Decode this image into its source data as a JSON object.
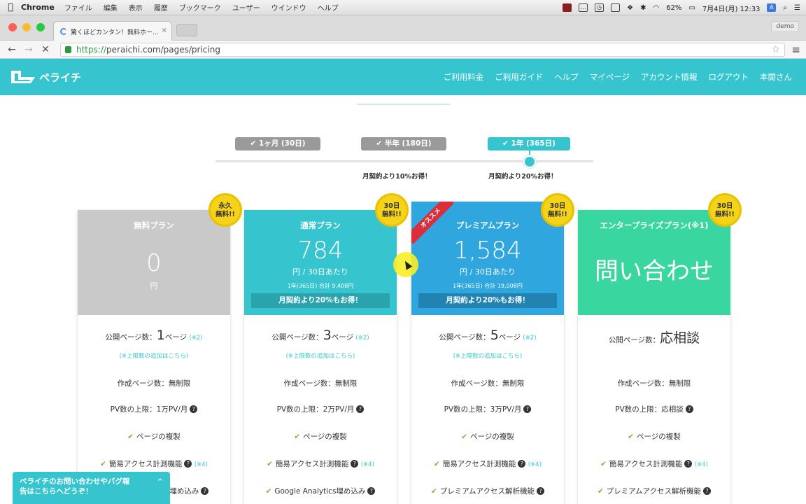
{
  "menubar": {
    "apple": "",
    "app": "Chrome",
    "items": [
      "ファイル",
      "編集",
      "表示",
      "履歴",
      "ブックマーク",
      "ユーザー",
      "ウインドウ",
      "ヘルプ"
    ],
    "battery": "62%",
    "clock": "7月4日(月)  12:33"
  },
  "browser": {
    "tab_title": "驚くほどカンタン！無料ホー...",
    "tab_close": "×",
    "profile": "demo",
    "url_scheme": "https://",
    "url_rest": "peraichi.com/pages/pricing"
  },
  "site": {
    "logo_text": "ペライチ",
    "nav": [
      "ご利用料金",
      "ご利用ガイド",
      "ヘルプ",
      "マイページ",
      "アカウント情報",
      "ログアウト",
      "本間さん"
    ]
  },
  "terms": {
    "options": [
      "✔ 1ヶ月 (30日)",
      "✔ 半年 (180日)",
      "✔ 1年 (365日)"
    ],
    "selected": "✔ 1年 (365日)",
    "discount_half": "月契約より10%お得！",
    "discount_year": "月契約より20%お得！"
  },
  "badges": [
    "永久\n無料!!",
    "30日\n無料!!",
    "30日\n無料!!",
    "30日\n無料!!"
  ],
  "ribbon": "オススメ",
  "plans": [
    {
      "name": "無料プラン",
      "price": "0",
      "unit": "円",
      "pages_label": "公開ページ数：",
      "pages_value": "1",
      "pages_suffix": "ページ",
      "pages_note": "(※2)",
      "pages_link": "(※上限数の追加はこちら)",
      "create_pages": "作成ページ数：無制限",
      "pv": "PV数の上限：1万PV/月",
      "feature_copy": "ページの複製",
      "feature_access": "簡易アクセス計測機能",
      "feature_access_note": "(※4)",
      "feature_extra": "Google Analytics埋め込み"
    },
    {
      "name": "通常プラン",
      "price": "784",
      "unit": "円 / 30日あたり",
      "total": "1年(365日) 合計 9,408円",
      "promo": "月契約より20%もお得！",
      "pages_label": "公開ページ数：",
      "pages_value": "3",
      "pages_suffix": "ページ",
      "pages_note": "(※2)",
      "pages_link": "(※上限数の追加はこちら)",
      "create_pages": "作成ページ数：無制限",
      "pv": "PV数の上限：2万PV/月",
      "feature_copy": "ページの複製",
      "feature_access": "簡易アクセス計測機能",
      "feature_access_note": "(※4)",
      "feature_extra": "Google Analytics埋め込み"
    },
    {
      "name": "プレミアムプラン",
      "price": "1,584",
      "unit": "円 / 30日あたり",
      "total": "1年(365日) 合計 19,008円",
      "promo": "月契約より20%もお得！",
      "pages_label": "公開ページ数：",
      "pages_value": "5",
      "pages_suffix": "ページ",
      "pages_note": "(※2)",
      "pages_link": "(※上限数の追加はこちら)",
      "create_pages": "作成ページ数：無制限",
      "pv": "PV数の上限：3万PV/月",
      "feature_copy": "ページの複製",
      "feature_access": "簡易アクセス計測機能",
      "feature_access_note": "(※4)",
      "feature_extra": "プレミアムアクセス解析機能"
    },
    {
      "name": "エンタープライズプラン(※1)",
      "price": "問い合わせ",
      "pages_label": "公開ページ数：",
      "pages_value": "応相談",
      "create_pages": "作成ページ数：無制限",
      "pv": "PV数の上限：応相談",
      "feature_copy": "ページの複製",
      "feature_access": "簡易アクセス計測機能",
      "feature_access_note": "(※4)",
      "feature_extra": "プレミアムアクセス解析機能"
    }
  ],
  "chat": {
    "line1": "ペライチのお問い合わせやバグ報",
    "line2": "告はこちらへどうぞ！",
    "chevron": "^"
  },
  "colors": {
    "brand": "#36c5cf",
    "free_card": "#c9c9c9",
    "standard_card": "#36c5cf",
    "premium_card": "#2fa6dd",
    "enterprise_card": "#3ad6a0",
    "badge": "#f5d31b",
    "ribbon": "#d92f3a"
  }
}
